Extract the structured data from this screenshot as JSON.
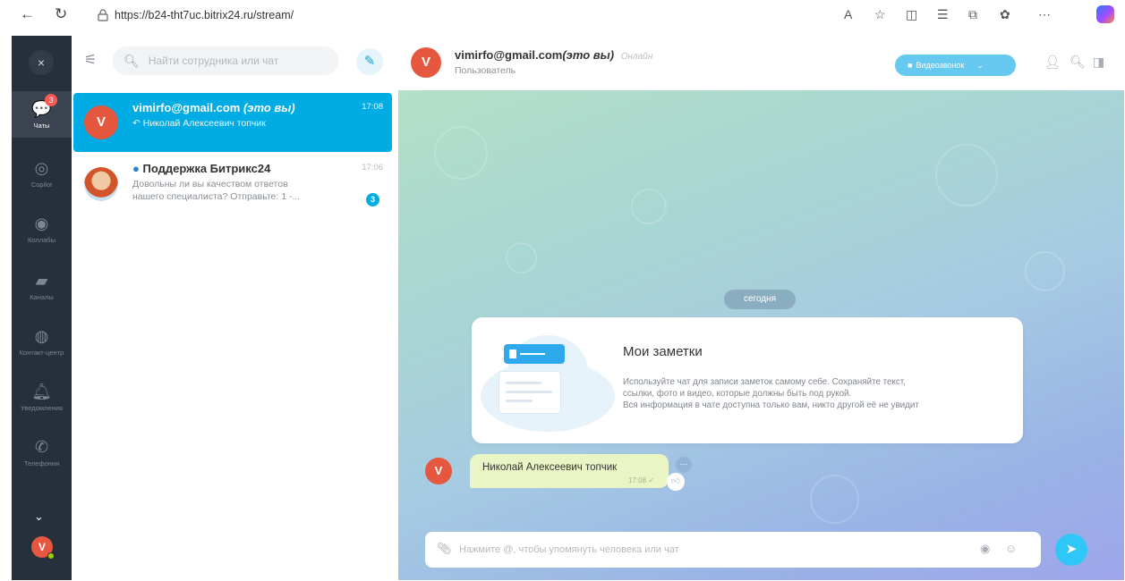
{
  "browser": {
    "url": "https://b24-tht7uc.bitrix24.ru/stream/"
  },
  "rail": {
    "close_icon": "×",
    "items": [
      {
        "label": "Чаты",
        "icon": "chat-icon",
        "badge": "3"
      },
      {
        "label": "Copilot",
        "icon": "copilot-icon"
      },
      {
        "label": "Коллабы",
        "icon": "collab-icon"
      },
      {
        "label": "Каналы",
        "icon": "channel-icon"
      },
      {
        "label": "Контакт-центр",
        "icon": "contact-center-icon"
      },
      {
        "label": "Уведомления",
        "icon": "bell-icon"
      },
      {
        "label": "Телефония",
        "icon": "phone-icon"
      }
    ],
    "user_initial": "V"
  },
  "list": {
    "search_placeholder": "Найти сотрудника или чат",
    "chats": [
      {
        "title": "vimirfo@gmail.com",
        "title_suffix": "(это вы)",
        "subtitle": "Николай Алексеевич топчик",
        "time": "17:08",
        "avatar_initial": "V",
        "active": true
      },
      {
        "title": "Поддержка Битрикс24",
        "subtitle_line1": "Довольны ли вы качеством ответов",
        "subtitle_line2": "нашего специалиста? Отправьте: 1 -...",
        "time": "17:06",
        "counter": "3",
        "active": false
      }
    ]
  },
  "chat": {
    "header": {
      "name": "vimirfo@gmail.com",
      "name_suffix": "(это вы)",
      "status": "Онлайн",
      "role": "Пользователь",
      "avatar_initial": "V",
      "video_button": "Видеозвонок"
    },
    "date_chip": "сегодня",
    "notes": {
      "title": "Мои заметки",
      "line1": "Используйте чат для записи заметок самому себе. Сохраняйте текст,",
      "line2": "ссылки, фото и видео, которые должны быть под рукой.",
      "line3": "Вся информация в чате доступна только вам, никто другой её не увидит"
    },
    "message": {
      "text": "Николай Алексеевич топчик",
      "time": "17:08",
      "avatar_initial": "V"
    },
    "input": {
      "placeholder": "Нажмите @, чтобы упомянуть человека или чат"
    }
  },
  "colors": {
    "rail_bg": "#272f3a",
    "accent": "#00ace3",
    "avatar_red": "#e5573e",
    "bubble": "#e9f5c5",
    "send": "#2fc7f7"
  }
}
